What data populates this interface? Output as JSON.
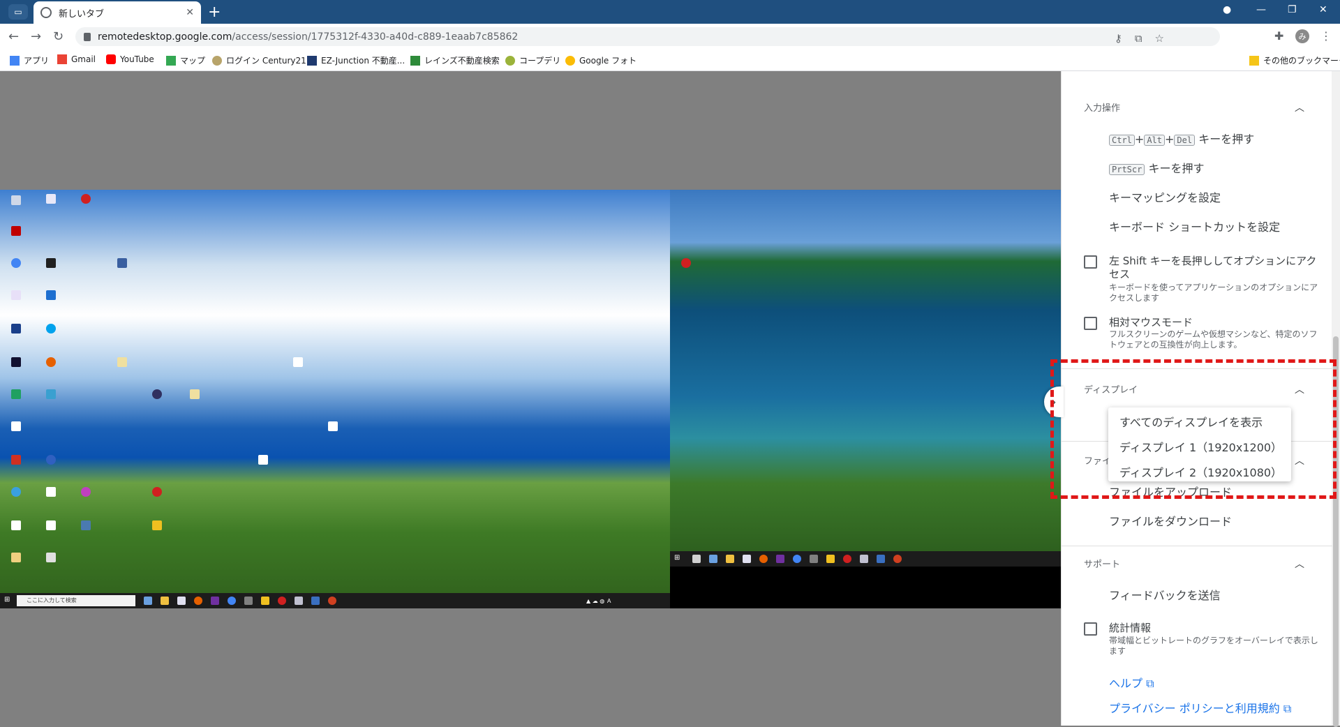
{
  "browser": {
    "tab_title": "新しいタブ",
    "new_tab_symbol": "+",
    "url_host": "remotedesktop.google.com",
    "url_path": "/access/session/1775312f-4330-a40d-c889-1eaab7c85862",
    "avatar_letter": "み"
  },
  "bookmarks": [
    {
      "label": "アプリ",
      "icon": "apps-grid-icon",
      "color": "#4285f4"
    },
    {
      "label": "Gmail",
      "icon": "gmail-icon",
      "color": "#ea4335"
    },
    {
      "label": "YouTube",
      "icon": "youtube-icon",
      "color": "#ff0000"
    },
    {
      "label": "マップ",
      "icon": "maps-icon",
      "color": "#34a853"
    },
    {
      "label": "ログイン Century21",
      "icon": "century21-icon",
      "color": "#b8a46a"
    },
    {
      "label": "EZ-Junction 不動産...",
      "icon": "ez-junction-icon",
      "color": "#1f3a6f"
    },
    {
      "label": "レインズ不動産検索",
      "icon": "reins-icon",
      "color": "#2e8b3a"
    },
    {
      "label": "コープデリ",
      "icon": "coopdeli-icon",
      "color": "#9bb33a"
    },
    {
      "label": "Google フォト",
      "icon": "google-photos-icon",
      "color": "#fbbc05"
    }
  ],
  "other_bookmarks": "その他のブックマーク",
  "remote": {
    "desktop1_search_placeholder": "ここに入力して検索"
  },
  "panel": {
    "input_section": {
      "title": "入力操作",
      "ctrl_alt_del": {
        "k1": "Ctrl",
        "k2": "Alt",
        "k3": "Del",
        "plus": "+",
        "suffix": "キーを押す"
      },
      "prtscr": {
        "key": "PrtScr",
        "suffix": "キーを押す"
      },
      "key_mapping": "キーマッピングを設定",
      "keyboard_shortcut": "キーボード ショートカットを設定",
      "shift_option_title": "左 Shift キーを長押ししてオプションにアクセス",
      "shift_option_desc": "キーボードを使ってアプリケーションのオプションにアクセスします",
      "relative_mouse_title": "相対マウスモード",
      "relative_mouse_desc": "フルスクリーンのゲームや仮想マシンなど、特定のソフトウェアとの互換性が向上します。"
    },
    "display_section": {
      "title": "ディスプレイ",
      "menu": [
        "すべてのディスプレイを表示",
        "ディスプレイ 1（1920x1200）",
        "ディスプレイ 2（1920x1080）"
      ]
    },
    "file_section": {
      "title_partial": "ファイ",
      "upload": "ファイルをアップロード",
      "download": "ファイルをダウンロード"
    },
    "support_section": {
      "title": "サポート",
      "feedback": "フィードバックを送信",
      "stats_title": "統計情報",
      "stats_desc": "帯域幅とビットレートのグラフをオーバーレイで表示します",
      "help": "ヘルプ",
      "privacy": "プライバシー ポリシーと利用規約"
    }
  },
  "colors": {
    "titlebar": "#1f4f7f",
    "highlight": "#e01818",
    "link": "#1a73e8"
  }
}
